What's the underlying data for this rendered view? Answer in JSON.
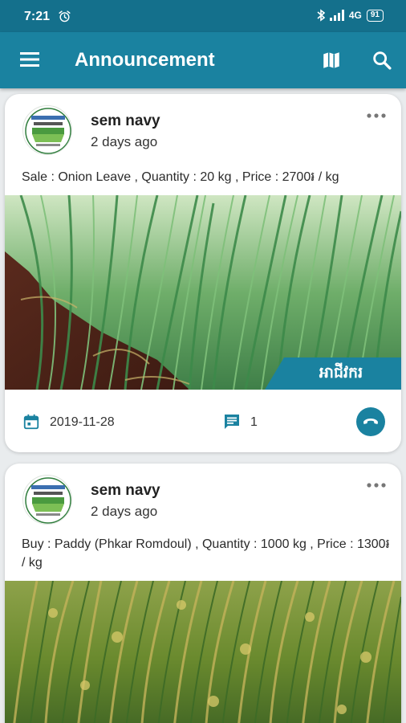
{
  "status_bar": {
    "time": "7:21",
    "network": "4G",
    "battery": "91"
  },
  "app_bar": {
    "title": "Announcement"
  },
  "posts": [
    {
      "author": "sem navy",
      "time_ago": "2 days ago",
      "text": "Sale : Onion Leave , Quantity : 20 kg , Price : 2700៛ / kg",
      "role_tag": "អាជីវករ",
      "date": "2019-11-28",
      "comment_count": "1"
    },
    {
      "author": "sem navy",
      "time_ago": "2 days ago",
      "text": "Buy : Paddy (Phkar Romdoul) , Quantity : 1000 kg , Price : 1300៛ / kg"
    }
  ],
  "colors": {
    "status_bar": "#14708c",
    "app_bar": "#1a82a0",
    "accent": "#1a82a0",
    "background": "#e9ecee"
  },
  "icons": [
    "alarm-icon",
    "bluetooth-icon",
    "signal-icon",
    "battery-icon",
    "menu-icon",
    "map-icon",
    "search-icon",
    "more-icon",
    "calendar-icon",
    "comment-icon",
    "phone-icon"
  ]
}
